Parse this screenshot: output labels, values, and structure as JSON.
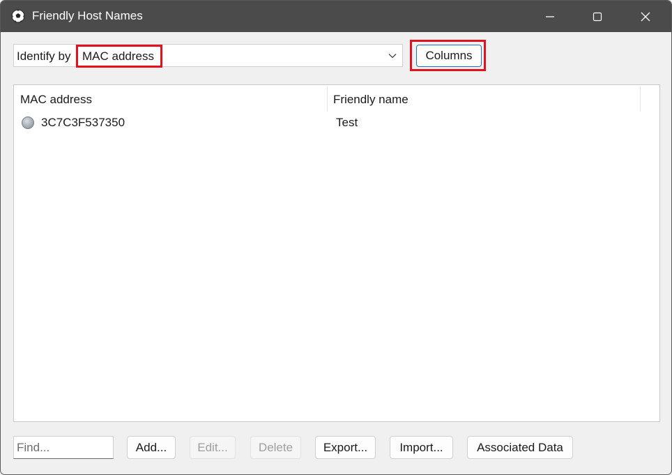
{
  "window": {
    "title": "Friendly Host Names",
    "icon": "soccer-ball-icon"
  },
  "identify": {
    "label": "Identify by",
    "value": "MAC address"
  },
  "toolbar": {
    "columns_label": "Columns"
  },
  "table": {
    "columns": [
      "MAC address",
      "Friendly name"
    ],
    "rows": [
      {
        "mac": "3C7C3F537350",
        "friendly_name": "Test",
        "status_icon": "gray-dot-icon"
      }
    ]
  },
  "footer": {
    "find_placeholder": "Find...",
    "add_label": "Add...",
    "edit_label": "Edit...",
    "delete_label": "Delete",
    "export_label": "Export...",
    "import_label": "Import...",
    "associated_label": "Associated Data"
  },
  "colors": {
    "titlebar": "#4b4b4b",
    "highlight": "#e3111d",
    "accent": "#1a6fc9"
  }
}
